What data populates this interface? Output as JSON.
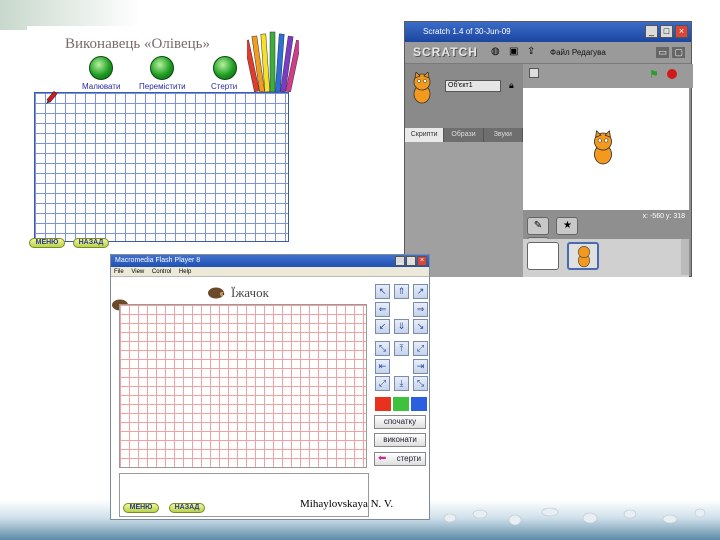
{
  "olivets": {
    "title": "Виконавець «Олівець»",
    "buttons": [
      {
        "label": "Малювати",
        "icon": "green-circle-icon"
      },
      {
        "label": "Перемістити",
        "icon": "green-circle-icon"
      },
      {
        "label": "Стерти",
        "icon": "green-circle-icon"
      }
    ],
    "menu_button": "МЕНЮ",
    "back_button": "НАЗАД",
    "pencil_icon": "pencil-icon",
    "grid_color": "#7d95d8"
  },
  "scratch": {
    "window_title": "Scratch 1.4 of 30-Jun-09",
    "logo": "SCRATCH",
    "menu": "Файл  Редагува",
    "sprite_name": "Об'єкт1",
    "tabs": [
      "Скрипти",
      "Образи",
      "Звуки"
    ],
    "coords": "x: -560  y: 318",
    "green_flag_color": "#2a9d2a",
    "stop_color": "#d01a1a"
  },
  "flash": {
    "window_title": "Macromedia Flash Player 8",
    "menu": [
      "File",
      "View",
      "Control",
      "Help"
    ],
    "title": "Їжачок",
    "buttons": {
      "start": "спочатку",
      "run": "виконати",
      "erase": "стерти"
    },
    "menu_button": "МЕНЮ",
    "back_button": "НАЗАД",
    "colors": [
      "#e8321e",
      "#3cc23c",
      "#2a5fe0"
    ],
    "grid_color": "#f2a0a0"
  },
  "signature": "Mihaylovskaya N. V."
}
